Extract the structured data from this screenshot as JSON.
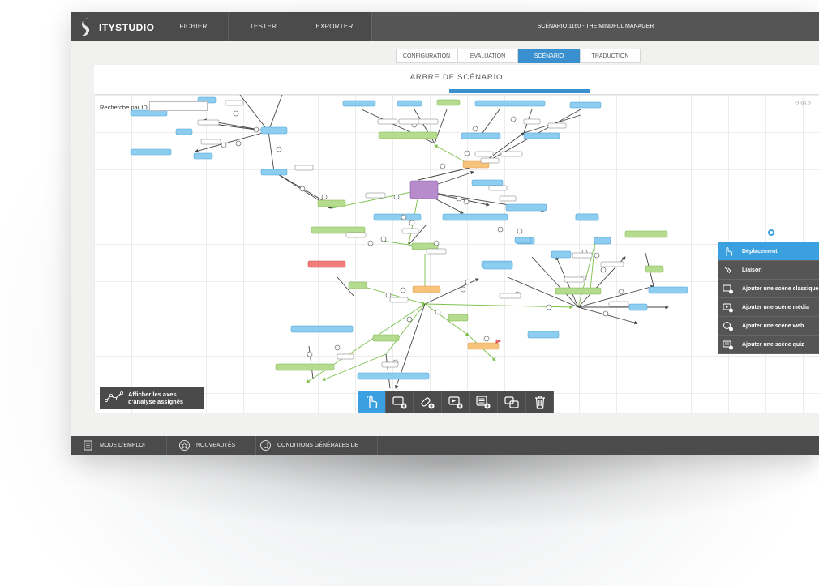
{
  "app": {
    "brand": "ITYSTUDIO",
    "menu": [
      "FICHIER",
      "TESTER",
      "EXPORTER"
    ],
    "scenario_title": "SCÉNARIO 1160 - THE MINDFUL MANAGER"
  },
  "tabs": [
    {
      "label": "CONFIGURATION",
      "active": false
    },
    {
      "label": "EVALUATION",
      "active": false
    },
    {
      "label": "SCÉNARIO",
      "active": true
    },
    {
      "label": "TRADUCTION",
      "active": false
    }
  ],
  "panel": {
    "title": "ARBRE DE SCÉNARIO",
    "search_label": "Recherche par ID",
    "search_value": "",
    "version": "r2.95.2"
  },
  "tool_menu": [
    {
      "label": "Déplacement",
      "icon": "hand-pointer-icon",
      "active": true
    },
    {
      "label": "Liaison",
      "icon": "link-icon",
      "active": false
    },
    {
      "label": "Ajouter une scène classique",
      "icon": "add-classic-scene-icon",
      "active": false
    },
    {
      "label": "Ajouter une scène média",
      "icon": "add-media-scene-icon",
      "active": false
    },
    {
      "label": "Ajouter une scène web",
      "icon": "add-web-scene-icon",
      "active": false
    },
    {
      "label": "Ajouter une scène quiz",
      "icon": "add-quiz-scene-icon",
      "active": false
    }
  ],
  "axes_button": {
    "line1": "Afficher les axes",
    "line2": "d'analyse assignés",
    "icon": "analysis-axes-icon"
  },
  "toolbar": [
    {
      "icon": "hand-pointer-icon",
      "active": true
    },
    {
      "icon": "add-classic-scene-icon",
      "active": false
    },
    {
      "icon": "add-web-scene-icon",
      "active": false
    },
    {
      "icon": "add-media-scene-icon",
      "active": false
    },
    {
      "icon": "add-quiz-scene-icon",
      "active": false
    },
    {
      "icon": "link-icon",
      "active": false
    },
    {
      "icon": "trash-icon",
      "active": false
    }
  ],
  "zoom": [
    {
      "icon": "center-icon"
    },
    {
      "icon": "zoom-in-icon"
    },
    {
      "icon": "zoom-out-icon"
    }
  ],
  "footer": [
    {
      "label": "MODE D'EMPLOI",
      "icon": "manual-icon"
    },
    {
      "label": "NOUVEAUTÉS",
      "icon": "star-icon"
    },
    {
      "label": "CONDITIONS GÉNÉRALES DE VENTE",
      "icon": "document-icon"
    }
  ],
  "colors": {
    "topbar": "#4b4b4b",
    "accent": "#3aa0e0",
    "scene_blue": "#8dcdf0",
    "scene_green": "#b5dc8e",
    "scene_orange": "#f7c27a",
    "scene_purple": "#b88ccc",
    "scene_red": "#f07c7c"
  }
}
